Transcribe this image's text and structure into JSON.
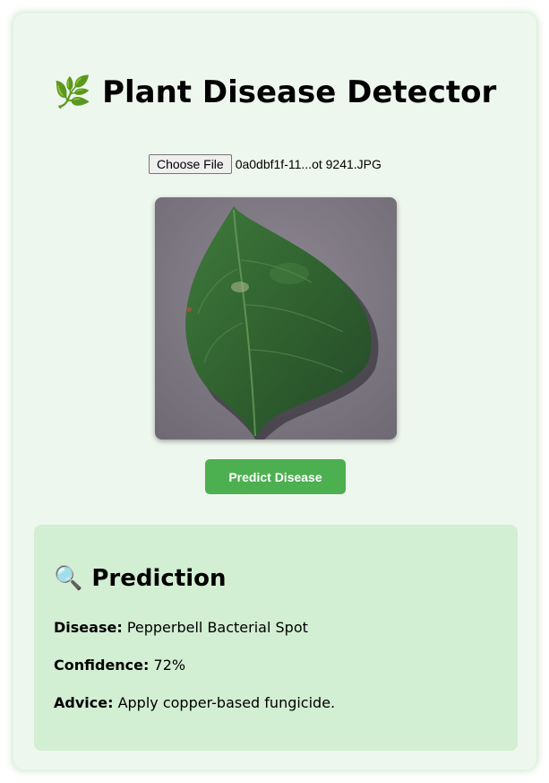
{
  "app": {
    "title": "Plant Disease Detector",
    "title_icon": "🌿"
  },
  "upload": {
    "button_label": "Choose File",
    "file_name": "0a0dbf1f-11...ot 9241.JPG"
  },
  "actions": {
    "predict_label": "Predict Disease"
  },
  "prediction": {
    "heading_icon": "🔍",
    "heading": "Prediction",
    "disease_label": "Disease:",
    "disease_value": "Pepperbell Bacterial Spot",
    "confidence_label": "Confidence:",
    "confidence_value": "72%",
    "advice_label": "Advice:",
    "advice_value": "Apply copper-based fungicide."
  },
  "colors": {
    "card_bg": "#eef7ee",
    "result_bg": "#d2eed3",
    "accent": "#4caf50"
  }
}
